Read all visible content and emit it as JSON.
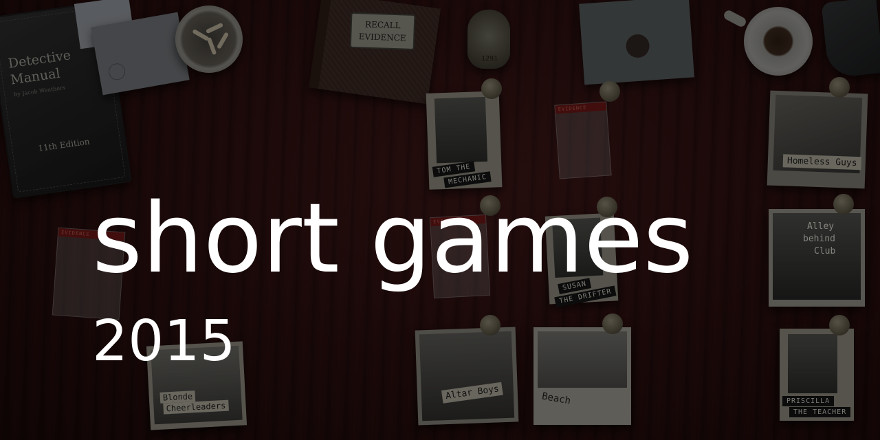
{
  "banner": {
    "title": "short games",
    "year": "2015"
  },
  "desk": {
    "manual_book": {
      "title_line1": "Detective",
      "title_line2": "Manual",
      "author": "by Jacob Weathers",
      "edition": "11th Edition"
    },
    "recall_book": {
      "line1": "RECALL",
      "line2": "EVIDENCE"
    },
    "badge_number": "1291"
  },
  "evidence": {
    "tom": {
      "caption_line1": "TOM THE",
      "caption_line2": "MECHANIC"
    },
    "bag1": {
      "tape": "EVIDENCE"
    },
    "bag2": {
      "tape": "EVIDENCE"
    },
    "bag3": {
      "tape": "EVIDENCE"
    },
    "homeless": {
      "label": "Homeless Guys"
    },
    "alley": {
      "line1": "Alley",
      "line2": "behind",
      "line3": "Club"
    },
    "susan": {
      "caption_line1": "SUSAN",
      "caption_line2": "THE DRIFTER"
    },
    "cheerleaders": {
      "line1": "Blonde",
      "line2": "Cheerleaders"
    },
    "altar": {
      "label": "Altar Boys"
    },
    "beach": {
      "label": "Beach"
    },
    "teacher": {
      "caption_line1": "PRISCILLA",
      "caption_line2": "THE TEACHER"
    }
  },
  "colors": {
    "desk_wood": "#2a0f0f",
    "title_text": "#ffffff",
    "evidence_tape": "#6a1716"
  }
}
